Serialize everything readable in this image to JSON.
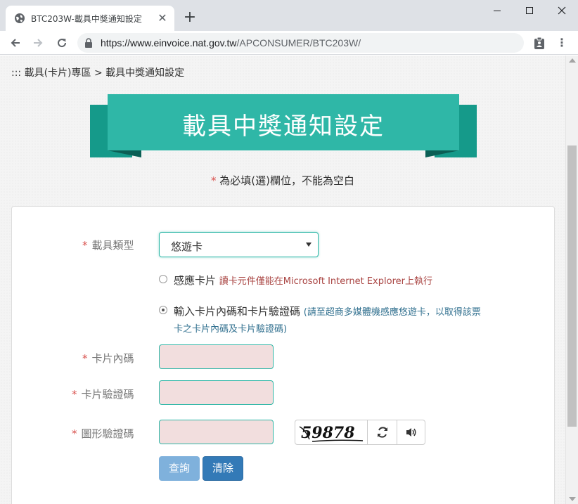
{
  "browser": {
    "tab_title": "BTC203W-載具中獎通知設定",
    "tab_close": "✕",
    "new_tab": "+",
    "url_host": "https://www.einvoice.nat.gov.tw",
    "url_path": "/APCONSUMER/BTC203W/"
  },
  "page": {
    "breadcrumb": "::: 載具(卡片)專區 > 載具中獎通知設定",
    "banner_title": "載具中獎通知設定",
    "required_star": "*",
    "required_note": " 為必填(選)欄位，不能為空白"
  },
  "form": {
    "carrier_type_label": "載具類型",
    "carrier_type_value": "悠遊卡",
    "radio_contact_label": "感應卡片",
    "radio_contact_note": "讀卡元件僅能在Microsoft Internet Explorer上執行",
    "radio_manual_label": "輸入卡片內碼和卡片驗證碼",
    "radio_manual_note_line1": "(請至超商多媒體機感應悠遊卡，以取得該票",
    "radio_manual_note_line2": "卡之卡片內碼及卡片驗證碼)",
    "radio_manual_checked": true,
    "card_code_label": "卡片內碼",
    "card_verify_label": "卡片驗證碼",
    "captcha_label": "圖形驗證碼",
    "captcha_text": "59878",
    "query_button": "查詢",
    "clear_button": "清除"
  },
  "colors": {
    "banner": "#2fb7a7",
    "banner_dark": "#159a8a",
    "required": "#d9534f",
    "input_bg": "#f2dede",
    "query_btn": "#7fb1dc",
    "clear_btn": "#337ab7"
  }
}
